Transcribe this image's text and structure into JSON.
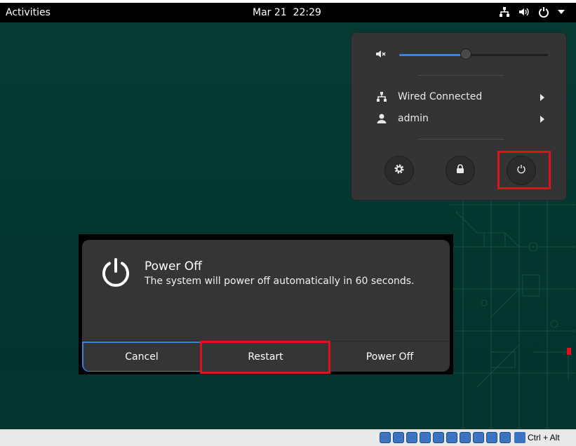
{
  "topbar": {
    "activities": "Activities",
    "clock": "Mar 21  22:29"
  },
  "status_menu": {
    "volume_percent": 45,
    "network_label": "Wired Connected",
    "user_label": "admin"
  },
  "dialog": {
    "title": "Power Off",
    "message": "The system will power off automatically in 60 seconds.",
    "cancel_label": "Cancel",
    "restart_label": "Restart",
    "poweroff_label": "Power Off"
  },
  "vm_statusbar": {
    "host_key": "Ctrl + Alt"
  },
  "colors": {
    "accent": "#3584e4",
    "highlight": "#e3101b",
    "wallpaper": "#053a33",
    "menu_bg": "#343434"
  },
  "icons": [
    "network-icon",
    "volume-icon",
    "power-icon",
    "chevron-down-icon",
    "volume-muted-icon",
    "user-icon",
    "settings-icon",
    "lock-icon",
    "arrow-right-icon"
  ]
}
